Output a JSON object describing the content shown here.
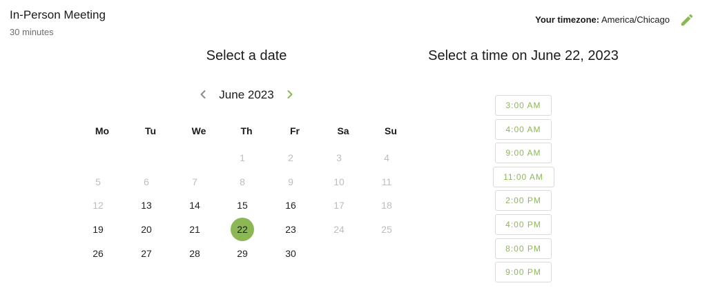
{
  "event": {
    "title": "In-Person Meeting",
    "duration": "30 minutes"
  },
  "timezone": {
    "label": "Your timezone:",
    "value": "America/Chicago",
    "edit_icon": "pencil-icon"
  },
  "colors": {
    "accent": "#8bb854",
    "disabled_day": "#bdbdbd",
    "slot_border": "#dadada"
  },
  "calendar": {
    "heading": "Select a date",
    "month": "June 2023",
    "prev_icon": "chevron-left-icon",
    "next_icon": "chevron-right-icon",
    "weekdays": [
      "Mo",
      "Tu",
      "We",
      "Th",
      "Fr",
      "Sa",
      "Su"
    ],
    "days": [
      {
        "label": "1",
        "available": false,
        "selected": false
      },
      {
        "label": "2",
        "available": false,
        "selected": false
      },
      {
        "label": "3",
        "available": false,
        "selected": false
      },
      {
        "label": "4",
        "available": false,
        "selected": false
      },
      {
        "label": "5",
        "available": false,
        "selected": false
      },
      {
        "label": "6",
        "available": false,
        "selected": false
      },
      {
        "label": "7",
        "available": false,
        "selected": false
      },
      {
        "label": "8",
        "available": false,
        "selected": false
      },
      {
        "label": "9",
        "available": false,
        "selected": false
      },
      {
        "label": "10",
        "available": false,
        "selected": false
      },
      {
        "label": "11",
        "available": false,
        "selected": false
      },
      {
        "label": "12",
        "available": false,
        "selected": false
      },
      {
        "label": "13",
        "available": true,
        "selected": false
      },
      {
        "label": "14",
        "available": true,
        "selected": false
      },
      {
        "label": "15",
        "available": true,
        "selected": false
      },
      {
        "label": "16",
        "available": true,
        "selected": false
      },
      {
        "label": "17",
        "available": false,
        "selected": false
      },
      {
        "label": "18",
        "available": false,
        "selected": false
      },
      {
        "label": "19",
        "available": true,
        "selected": false
      },
      {
        "label": "20",
        "available": true,
        "selected": false
      },
      {
        "label": "21",
        "available": true,
        "selected": false
      },
      {
        "label": "22",
        "available": true,
        "selected": true
      },
      {
        "label": "23",
        "available": true,
        "selected": false
      },
      {
        "label": "24",
        "available": false,
        "selected": false
      },
      {
        "label": "25",
        "available": false,
        "selected": false
      },
      {
        "label": "26",
        "available": true,
        "selected": false
      },
      {
        "label": "27",
        "available": true,
        "selected": false
      },
      {
        "label": "28",
        "available": true,
        "selected": false
      },
      {
        "label": "29",
        "available": true,
        "selected": false
      },
      {
        "label": "30",
        "available": true,
        "selected": false
      }
    ]
  },
  "times": {
    "heading": "Select a time on June 22, 2023",
    "slots": [
      "3:00 AM",
      "4:00 AM",
      "9:00 AM",
      "11:00 AM",
      "2:00 PM",
      "4:00 PM",
      "8:00 PM",
      "9:00 PM"
    ]
  }
}
